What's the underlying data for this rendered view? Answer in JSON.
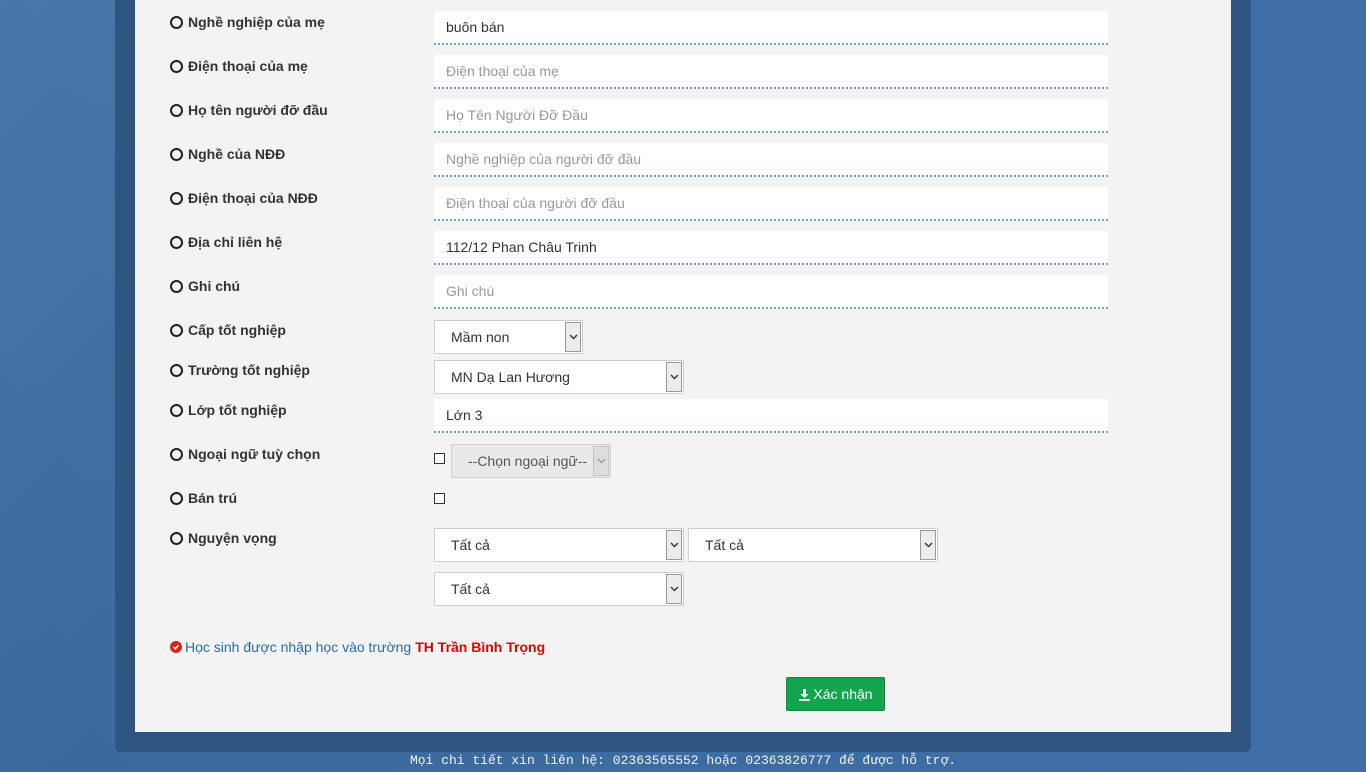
{
  "form": {
    "rows": [
      {
        "label": "Nghề nghiệp của mẹ",
        "value": "buôn bán",
        "placeholder": ""
      },
      {
        "label": "Điện thoại của mẹ",
        "value": "",
        "placeholder": "Điện thoại của mẹ"
      },
      {
        "label": "Họ tên người đỡ đầu",
        "value": "",
        "placeholder": "Họ Tên Người Đỡ Đầu"
      },
      {
        "label": "Nghề của NĐĐ",
        "value": "",
        "placeholder": "Nghề nghiệp của người đỡ đầu"
      },
      {
        "label": "Điện thoại của NĐĐ",
        "value": "",
        "placeholder": "Điện thoại của người đỡ đầu"
      },
      {
        "label": "Địa chỉ liên hệ",
        "value": "112/12 Phan Châu Trinh",
        "placeholder": ""
      },
      {
        "label": "Ghi chú",
        "value": "",
        "placeholder": "Ghi chú"
      }
    ],
    "cap_tot_nghiep": {
      "label": "Cấp tốt nghiệp",
      "selected": "Mầm non"
    },
    "truong_tot_nghiep": {
      "label": "Trường tốt nghiệp",
      "selected": "MN Dạ Lan Hương"
    },
    "lop_tot_nghiep": {
      "label": "Lớp tốt nghiệp",
      "value": "Lớn 3"
    },
    "ngoai_ngu": {
      "label": "Ngoại ngữ tuỳ chọn",
      "checked": false,
      "selected": "--Chọn ngoại ngữ--"
    },
    "ban_tru": {
      "label": "Bán trú",
      "checked": false
    },
    "nguyen_vong": {
      "label": "Nguyện vọng",
      "select1": "Tất cả",
      "select2": "Tất cả",
      "select3": "Tất cả"
    }
  },
  "notice": {
    "text": "Học sinh được nhập học vào trường",
    "school": "TH Trần Bình Trọng",
    "school_color": "#e00000"
  },
  "submit": {
    "label": "Xác nhận",
    "color": "#13a54d"
  },
  "footer": {
    "text": "Mọi chi tiết xin liên hệ: 02363565552 hoặc 02363826777 để được hỗ trợ."
  }
}
